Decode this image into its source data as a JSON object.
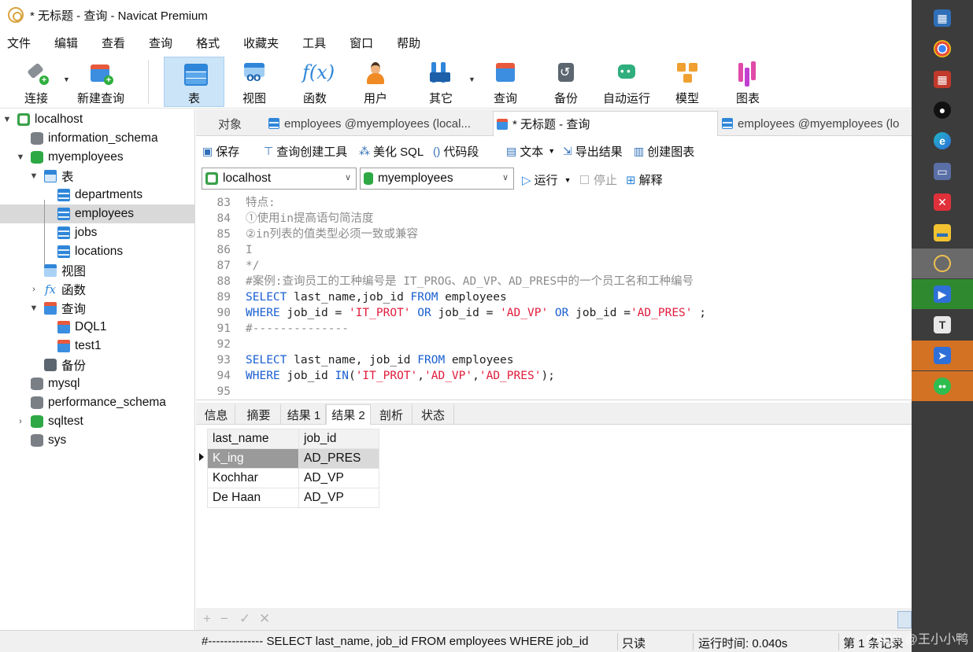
{
  "window": {
    "title": "* 无标题 - 查询 - Navicat Premium"
  },
  "menu": [
    "文件",
    "编辑",
    "查看",
    "查询",
    "格式",
    "收藏夹",
    "工具",
    "窗口",
    "帮助"
  ],
  "toolbar": {
    "connect": "连接",
    "new_query": "新建查询",
    "table": "表",
    "view": "视图",
    "function": "函数",
    "user": "用户",
    "other": "其它",
    "query": "查询",
    "backup": "备份",
    "automation": "自动运行",
    "model": "模型",
    "chart": "图表",
    "active": "表"
  },
  "navigator": {
    "rows": [
      {
        "label": "localhost",
        "icon": "server-icon"
      },
      {
        "label": "information_schema",
        "icon": "database-icon"
      },
      {
        "label": "myemployees",
        "icon": "database-icon"
      },
      {
        "label": "表",
        "icon": "tables-icon"
      },
      {
        "label": "departments",
        "icon": "table-icon"
      },
      {
        "label": "employees",
        "icon": "table-icon",
        "selected": true
      },
      {
        "label": "jobs",
        "icon": "table-icon"
      },
      {
        "label": "locations",
        "icon": "table-icon"
      },
      {
        "label": "视图",
        "icon": "view-icon"
      },
      {
        "label": "函数",
        "icon": "function-icon"
      },
      {
        "label": "查询",
        "icon": "query-icon"
      },
      {
        "label": "DQL1",
        "icon": "query-icon"
      },
      {
        "label": "test1",
        "icon": "query-icon"
      },
      {
        "label": "备份",
        "icon": "backup-icon"
      },
      {
        "label": "mysql",
        "icon": "database-icon"
      },
      {
        "label": "performance_schema",
        "icon": "database-icon"
      },
      {
        "label": "sqltest",
        "icon": "database-icon"
      },
      {
        "label": "sys",
        "icon": "database-icon"
      }
    ]
  },
  "tabs": {
    "objects": "对象",
    "tab1": "employees @myemployees (local...",
    "tab2": "* 无标题 - 查询",
    "tab3": "employees @myemployees (lo"
  },
  "query_toolbar": {
    "save": "保存",
    "builder": "查询创建工具",
    "beautify": "美化 SQL",
    "snippet": "代码段",
    "text": "文本",
    "export": "导出结果",
    "create_chart": "创建图表"
  },
  "connection": {
    "server": "localhost",
    "database": "myemployees",
    "run": "运行",
    "stop": "停止",
    "explain": "解释"
  },
  "editor": {
    "lines": [
      {
        "n": "83",
        "parts": [
          {
            "t": "特点:",
            "c": "cmt"
          }
        ]
      },
      {
        "n": "84",
        "parts": [
          {
            "t": "①使用in提高语句简洁度",
            "c": "cmt"
          }
        ]
      },
      {
        "n": "85",
        "parts": [
          {
            "t": "②in列表的值类型必须一致或兼容",
            "c": "cmt"
          }
        ]
      },
      {
        "n": "86",
        "parts": [
          {
            "t": "I",
            "c": "cmt"
          }
        ]
      },
      {
        "n": "87",
        "parts": [
          {
            "t": "*/",
            "c": "cmt"
          }
        ]
      },
      {
        "n": "88",
        "parts": [
          {
            "t": "#案例:查询员工的工种编号是 IT_PROG、AD_VP、AD_PRES中的一个员工名和工种编号",
            "c": "cmt"
          }
        ]
      },
      {
        "n": "89",
        "parts": [
          {
            "t": "SELECT",
            "c": "kw"
          },
          {
            "t": " last_name,job_id ",
            "c": "plain"
          },
          {
            "t": "FROM",
            "c": "kw"
          },
          {
            "t": " employees",
            "c": "plain"
          }
        ]
      },
      {
        "n": "90",
        "parts": [
          {
            "t": "WHERE",
            "c": "kw"
          },
          {
            "t": " job_id = ",
            "c": "plain"
          },
          {
            "t": "'IT_PROT'",
            "c": "str"
          },
          {
            "t": " ",
            "c": "plain"
          },
          {
            "t": "OR",
            "c": "kw"
          },
          {
            "t": " job_id = ",
            "c": "plain"
          },
          {
            "t": "'AD_VP'",
            "c": "str"
          },
          {
            "t": " ",
            "c": "plain"
          },
          {
            "t": "OR",
            "c": "kw"
          },
          {
            "t": " job_id =",
            "c": "plain"
          },
          {
            "t": "'AD_PRES'",
            "c": "str"
          },
          {
            "t": " ;",
            "c": "plain"
          }
        ]
      },
      {
        "n": "91",
        "parts": [
          {
            "t": "#--------------",
            "c": "cmt"
          }
        ]
      },
      {
        "n": "92",
        "parts": []
      },
      {
        "n": "93",
        "parts": [
          {
            "t": "SELECT",
            "c": "kw"
          },
          {
            "t": " last_name, job_id ",
            "c": "plain"
          },
          {
            "t": "FROM",
            "c": "kw"
          },
          {
            "t": " employees",
            "c": "plain"
          }
        ]
      },
      {
        "n": "94",
        "parts": [
          {
            "t": "WHERE",
            "c": "kw"
          },
          {
            "t": " job_id ",
            "c": "plain"
          },
          {
            "t": "IN",
            "c": "kw"
          },
          {
            "t": "(",
            "c": "plain"
          },
          {
            "t": "'IT_PROT'",
            "c": "str"
          },
          {
            "t": ",",
            "c": "plain"
          },
          {
            "t": "'AD_VP'",
            "c": "str"
          },
          {
            "t": ",",
            "c": "plain"
          },
          {
            "t": "'AD_PRES'",
            "c": "str"
          },
          {
            "t": ");",
            "c": "plain"
          }
        ]
      },
      {
        "n": "95",
        "parts": []
      }
    ]
  },
  "results": {
    "tabs": [
      "信息",
      "摘要",
      "结果 1",
      "结果 2",
      "剖析",
      "状态"
    ],
    "active_tab": "结果 2",
    "columns": [
      "last_name",
      "job_id"
    ],
    "rows": [
      [
        "K_ing",
        "AD_PRES"
      ],
      [
        "Kochhar",
        "AD_VP"
      ],
      [
        "De Haan",
        "AD_VP"
      ]
    ],
    "footer_buttons": [
      "+",
      "−",
      "✓",
      "✕"
    ]
  },
  "status": {
    "sql": "#--------------  SELECT last_name, job_id FROM employees WHERE job_id",
    "readonly": "只读",
    "runtime": "运行时间: 0.040s",
    "records": "第 1 条记录"
  },
  "taskbar": {
    "watermark": "CSDN @王小小鸭"
  }
}
